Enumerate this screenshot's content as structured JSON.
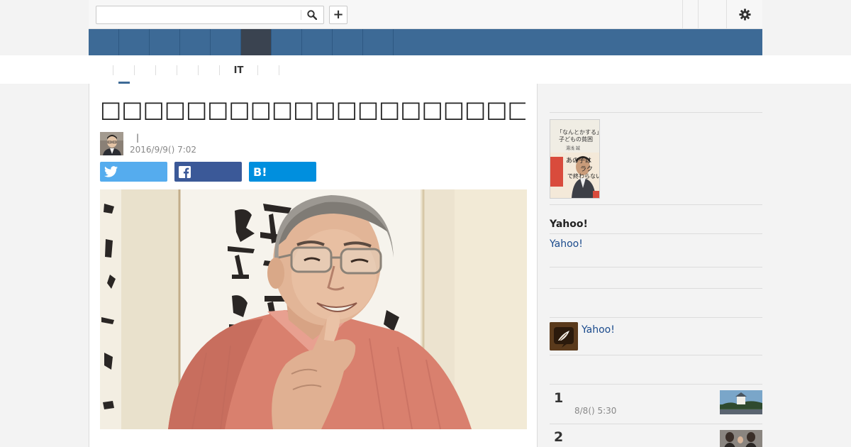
{
  "search": {
    "placeholder": "",
    "value": "",
    "icon": "search-icon"
  },
  "toolbar": {
    "add_label": "+",
    "settings_icon": "gear-icon"
  },
  "nav": {
    "items": [
      {
        "label": ""
      },
      {
        "label": ""
      },
      {
        "label": ""
      },
      {
        "label": ""
      },
      {
        "label": ""
      },
      {
        "label": ""
      },
      {
        "label": ""
      },
      {
        "label": ""
      },
      {
        "label": ""
      },
      {
        "label": ""
      }
    ],
    "active_index": 5,
    "bg_color": "#3d6a96",
    "active_color": "#3a4350"
  },
  "subnav": {
    "items": [
      {
        "label": ""
      },
      {
        "label": ""
      },
      {
        "label": ""
      },
      {
        "label": ""
      },
      {
        "label": ""
      },
      {
        "label": ""
      },
      {
        "label": "IT"
      },
      {
        "label": ""
      }
    ]
  },
  "article": {
    "title": "□□□□□□□□□□□□□□□□□□□□□□□□□□□□□□□□□□□□□",
    "author": {
      "name": "",
      "separator": "|"
    },
    "date": "2016/9/9() 7:02",
    "share": {
      "twitter_icon": "twitter-icon",
      "facebook_icon": "facebook-icon",
      "hatena_label": "B!",
      "twitter_color": "#55acee",
      "facebook_color": "#3b5998",
      "hatena_color": "#008fde"
    }
  },
  "sidebar": {
    "book": {
      "title_line1": "「なんとかする」",
      "title_line2": "子どもの貧困",
      "author": "湯浅 誠",
      "tagline1": "あの子は",
      "tagline2": "ラク",
      "tagline3": "で終わらない"
    },
    "heading": "Yahoo!",
    "link": "Yahoo!",
    "app_link": "Yahoo!",
    "ranking": [
      {
        "rank": "1",
        "date": "8/8() 5:30"
      },
      {
        "rank": "2",
        "date": ""
      }
    ]
  }
}
